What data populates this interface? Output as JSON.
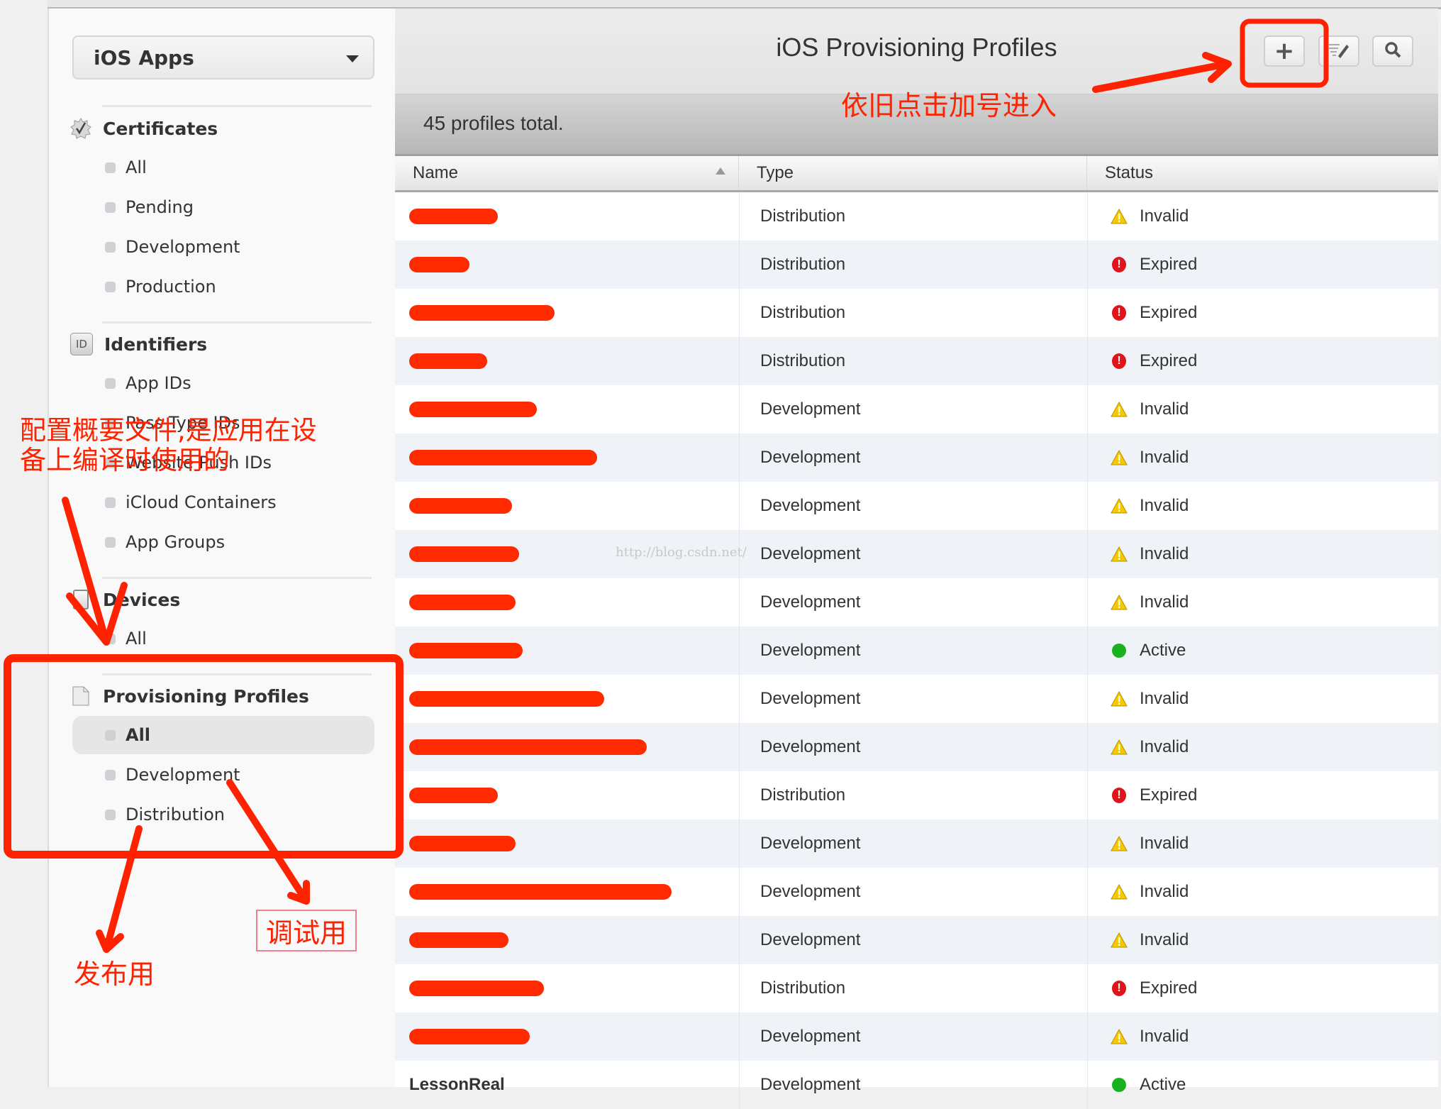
{
  "sidebar": {
    "platform_selector": "iOS Apps",
    "sections": [
      {
        "title": "Certificates",
        "icon": "certificate-badge-icon",
        "items": [
          "All",
          "Pending",
          "Development",
          "Production"
        ]
      },
      {
        "title": "Identifiers",
        "icon": "id-badge-icon",
        "icon_text": "ID",
        "items": [
          "App IDs",
          "Pass Type IDs",
          "Website Push IDs",
          "iCloud Containers",
          "App Groups"
        ]
      },
      {
        "title": "Devices",
        "icon": "device-icon",
        "items": [
          "All"
        ]
      },
      {
        "title": "Provisioning Profiles",
        "icon": "document-icon",
        "items": [
          "All",
          "Development",
          "Distribution"
        ],
        "selected": "All"
      }
    ]
  },
  "header": {
    "title": "iOS Provisioning Profiles",
    "buttons": [
      {
        "name": "add",
        "icon": "plus-icon"
      },
      {
        "name": "edit",
        "icon": "edit-list-icon"
      },
      {
        "name": "search",
        "icon": "search-icon"
      }
    ]
  },
  "summary": "45 profiles total.",
  "table": {
    "columns": [
      "Name",
      "Type",
      "Status"
    ],
    "sorted_by": "Name",
    "rows": [
      {
        "name": "",
        "type": "Distribution",
        "status": "Invalid"
      },
      {
        "name": "",
        "type": "Distribution",
        "status": "Expired"
      },
      {
        "name": "",
        "type": "Distribution",
        "status": "Expired"
      },
      {
        "name": "",
        "type": "Distribution",
        "status": "Expired"
      },
      {
        "name": "",
        "type": "Development",
        "status": "Invalid"
      },
      {
        "name": "",
        "type": "Development",
        "status": "Invalid"
      },
      {
        "name": "",
        "type": "Development",
        "status": "Invalid"
      },
      {
        "name": "",
        "type": "Development",
        "status": "Invalid"
      },
      {
        "name": "",
        "type": "Development",
        "status": "Invalid"
      },
      {
        "name": "",
        "type": "Development",
        "status": "Active"
      },
      {
        "name": "",
        "type": "Development",
        "status": "Invalid"
      },
      {
        "name": "",
        "type": "Development",
        "status": "Invalid"
      },
      {
        "name": "",
        "type": "Distribution",
        "status": "Expired"
      },
      {
        "name": "",
        "type": "Development",
        "status": "Invalid"
      },
      {
        "name": "",
        "type": "Development",
        "status": "Invalid"
      },
      {
        "name": "",
        "type": "Development",
        "status": "Invalid"
      },
      {
        "name": "",
        "type": "Distribution",
        "status": "Expired"
      },
      {
        "name": "",
        "type": "Development",
        "status": "Invalid"
      },
      {
        "name": "LessonReal",
        "type": "Development",
        "status": "Active"
      }
    ]
  },
  "status_colors": {
    "Invalid": "#f5c800",
    "Expired": "#e0141b",
    "Active": "#19b21f"
  },
  "watermark": "http://blog.csdn.net/",
  "annotations": {
    "add_hint": "依旧点击加号进入",
    "profiles_hint_line1": "配置概要文件,是应用在设",
    "profiles_hint_line2": "备上编译时使用的",
    "distribution_hint": "发布用",
    "development_hint": "调试用",
    "color": "#ff2200"
  }
}
